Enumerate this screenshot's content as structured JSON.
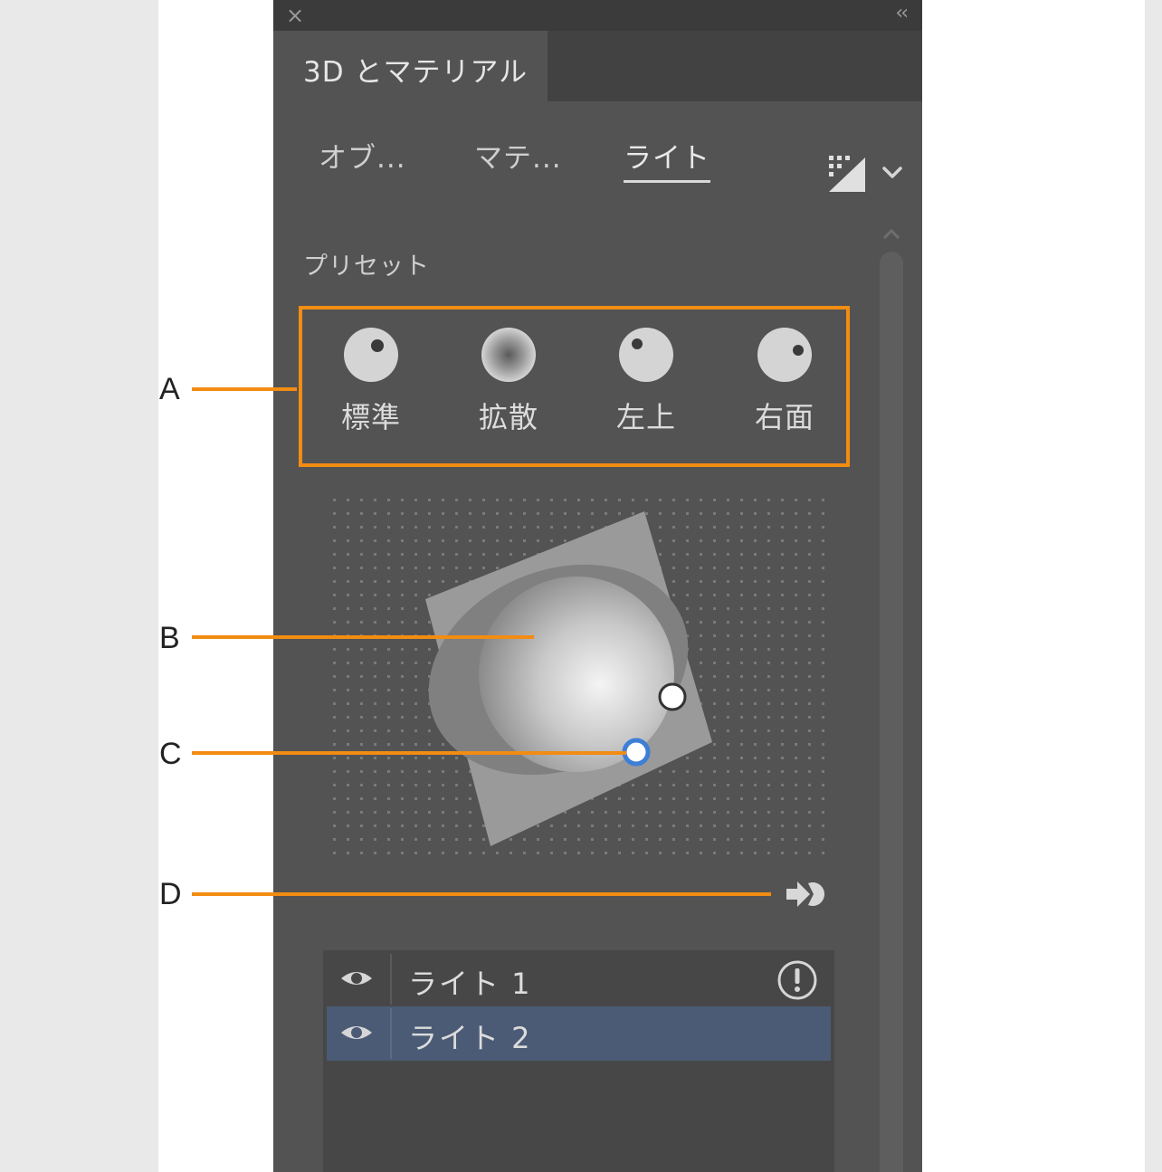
{
  "panel": {
    "title": "3D とマテリアル",
    "close_glyph": "×",
    "collapse_glyph": "‹‹"
  },
  "subtabs": [
    {
      "label": "オブ..."
    },
    {
      "label": "マテ..."
    },
    {
      "label": "ライト",
      "active": true
    }
  ],
  "presets": {
    "label": "プリセット",
    "items": [
      {
        "label": "標準"
      },
      {
        "label": "拡散"
      },
      {
        "label": "左上"
      },
      {
        "label": "右面"
      }
    ]
  },
  "lights": [
    {
      "name": "ライト 1",
      "warning": true,
      "selected": false
    },
    {
      "name": "ライト 2",
      "warning": false,
      "selected": true
    }
  ],
  "annotations": {
    "a": "A",
    "b": "B",
    "c": "C",
    "d": "D"
  },
  "colors": {
    "accent": "#f28c12",
    "panel": "#535353",
    "selected_row": "#4b5b75",
    "handle_blue": "#3d7fd6"
  },
  "icons": {
    "close": "close-icon",
    "collapse": "collapse-panel-icon",
    "render": "render-icon",
    "dropdown": "chevron-down-icon",
    "move_light_to_back": "move-light-icon",
    "visibility": "eye-icon",
    "warning": "warning-icon"
  }
}
